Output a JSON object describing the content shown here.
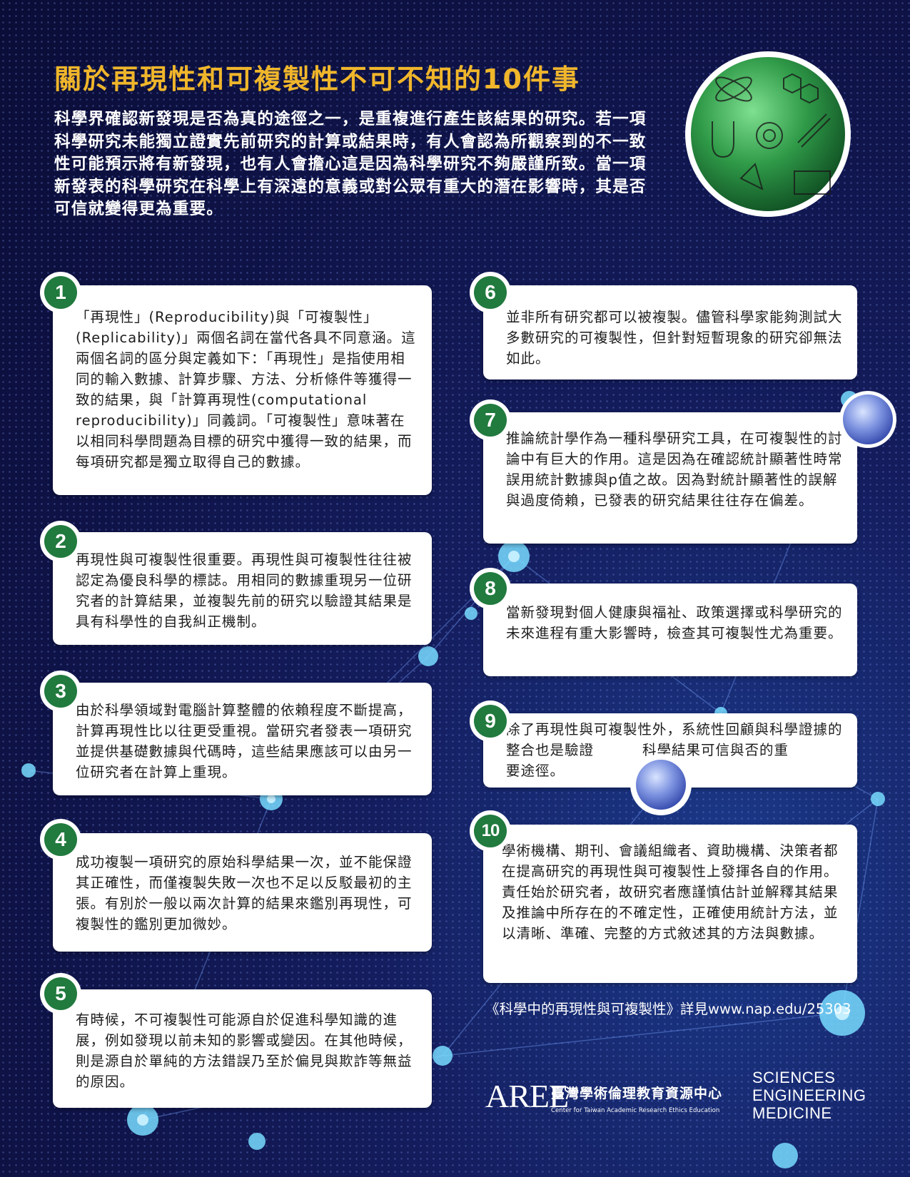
{
  "title": "關於再現性和可複製性不可不知的10件事",
  "intro": "科學界確認新發現是否為真的途徑之一，是重複進行產生該結果的研究。若一項科學研究未能獨立證實先前研究的計算或結果時，有人會認為所觀察到的不一致性可能預示將有新發現，也有人會擔心這是因為科學研究不夠嚴謹所致。當一項新發表的科學研究在科學上有深遠的意義或對公眾有重大的潛在影響時，其是否可信就變得更為重要。",
  "items": [
    {
      "number": "1",
      "text": "「再現性」(Reproducibility)與「可複製性」(Replicability)」兩個名詞在當代各具不同意涵。這兩個名詞的區分與定義如下：「再現性」是指使用相同的輸入數據、計算步驟、方法、分析條件等獲得一致的結果，與「計算再現性(computational reproducibility)」同義詞。「可複製性」意味著在以相同科學問題為目標的研究中獲得一致的結果，而每項研究都是獨立取得自己的數據。"
    },
    {
      "number": "2",
      "text": "再現性與可複製性很重要。再現性與可複製性往往被認定為優良科學的標誌。用相同的數據重現另一位研究者的計算結果，並複製先前的研究以驗證其結果是具有科學性的自我糾正機制。"
    },
    {
      "number": "3",
      "text": "由於科學領域對電腦計算整體的依賴程度不斷提高，計算再現性比以往更受重視。當研究者發表一項研究並提供基礎數據與代碼時，這些結果應該可以由另一位研究者在計算上重現。"
    },
    {
      "number": "4",
      "text": "成功複製一項研究的原始科學結果一次，並不能保證其正確性，而僅複製失敗一次也不足以反駁最初的主張。有別於一般以兩次計算的結果來鑑別再現性，可複製性的鑑別更加微妙。"
    },
    {
      "number": "5",
      "text": "有時候，不可複製性可能源自於促進科學知識的進展，例如發現以前未知的影響或變因。在其他時候，則是源自於單純的方法錯誤乃至於偏見與欺詐等無益的原因。"
    },
    {
      "number": "6",
      "text": "並非所有研究都可以被複製。儘管科學家能夠測試大多數研究的可複製性，但針對短暫現象的研究卻無法如此。"
    },
    {
      "number": "7",
      "text": "推論統計學作為一種科學研究工具，在可複製性的討論中有巨大的作用。這是因為在確認統計顯著性時常誤用統計數據與p值之故。因為對統計顯著性的誤解與過度倚賴，已發表的研究結果往往存在偏差。"
    },
    {
      "number": "8",
      "text": "當新發現對個人健康與福祉、政策選擇或科學研究的未來進程有重大影響時，檢查其可複製性尤為重要。"
    },
    {
      "number": "9",
      "text_a": "除了再現性與可複製性外，系統性回顧與科學證據的整合也是驗證",
      "text_b": "科學結果可信與否的重",
      "text_c": "要途徑。"
    },
    {
      "number": "10",
      "text": "學術機構、期刊、會議組織者、資助機構、決策者都在提高研究的再現性與可複製性上發揮各自的作用。責任始於研究者，故研究者應謹慎估計並解釋其結果及推論中所存在的不確定性，正確使用統計方法，並以清晰、準確、完整的方式敘述其的方法與數據。"
    }
  ],
  "source": "《科學中的再現性與可複製性》詳見www.nap.edu/25303",
  "logos": {
    "aree_mark": "AREE",
    "aree_cn": "臺灣學術倫理教育資源中心",
    "aree_en": "Center for Taiwan Academic Research Ethics Education",
    "nas_line1": "SCIENCES",
    "nas_line2": "ENGINEERING",
    "nas_line3": "MEDICINE"
  },
  "colors": {
    "title": "#f0b62b",
    "number_badge": "#217a3e",
    "background": "#141d5e"
  }
}
